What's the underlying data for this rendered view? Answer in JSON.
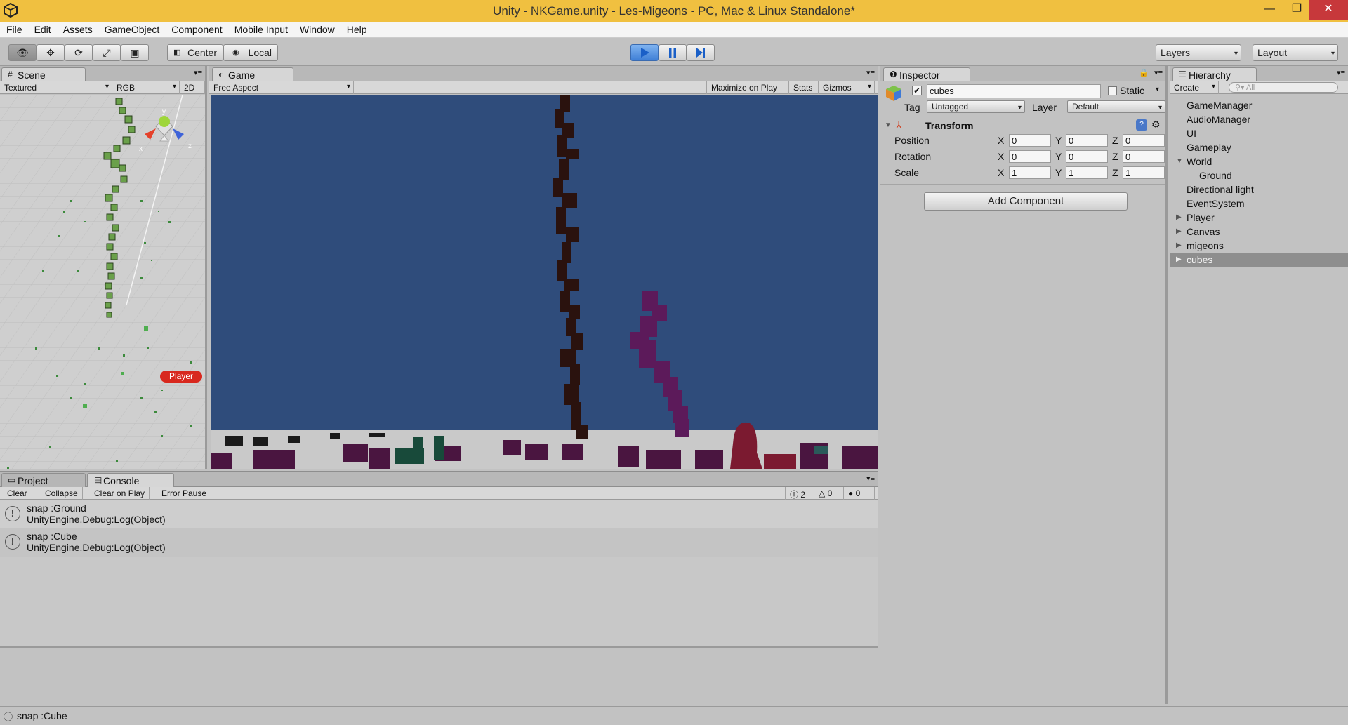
{
  "window": {
    "title": "Unity - NKGame.unity - Les-Migeons - PC, Mac & Linux Standalone*",
    "minimize": "—",
    "maximize": "❐",
    "close": "✕"
  },
  "menu": [
    "File",
    "Edit",
    "Assets",
    "GameObject",
    "Component",
    "Mobile Input",
    "Window",
    "Help"
  ],
  "toolbar": {
    "pivot": "Center",
    "space": "Local",
    "layers": "Layers",
    "layout": "Layout"
  },
  "scene": {
    "tab": "Scene",
    "render_mode": "Textured",
    "channel": "RGB",
    "mode2d": "2D",
    "player_label": "Player",
    "axis_y": "y",
    "axis_z": "z",
    "axis_x": "x"
  },
  "game": {
    "tab": "Game",
    "aspect": "Free Aspect",
    "maximize": "Maximize on Play",
    "stats": "Stats",
    "gizmos": "Gizmos"
  },
  "inspector": {
    "tab": "Inspector",
    "object_name": "cubes",
    "static_label": "Static",
    "tag_label": "Tag",
    "tag_value": "Untagged",
    "layer_label": "Layer",
    "layer_value": "Default",
    "component": "Transform",
    "rows": [
      {
        "label": "Position",
        "x": "0",
        "y": "0",
        "z": "0"
      },
      {
        "label": "Rotation",
        "x": "0",
        "y": "0",
        "z": "0"
      },
      {
        "label": "Scale",
        "x": "1",
        "y": "1",
        "z": "1"
      }
    ],
    "axis_x": "X",
    "axis_y": "Y",
    "axis_z": "Z",
    "add_component": "Add Component"
  },
  "hierarchy": {
    "tab": "Hierarchy",
    "create": "Create",
    "search_placeholder": "All",
    "items": [
      "GameManager",
      "AudioManager",
      "UI",
      "Gameplay",
      "World",
      "Ground",
      "Directional light",
      "EventSystem",
      "Player",
      "Canvas",
      "migeons",
      "cubes"
    ]
  },
  "bottom": {
    "project_tab": "Project",
    "console_tab": "Console"
  },
  "console": {
    "clear": "Clear",
    "collapse": "Collapse",
    "clear_on_play": "Clear on Play",
    "error_pause": "Error Pause",
    "log_count": "2",
    "warn_count": "0",
    "error_count": "0",
    "entries": [
      {
        "line1": "snap :Ground",
        "line2": "UnityEngine.Debug:Log(Object)"
      },
      {
        "line1": "snap :Cube",
        "line2": "UnityEngine.Debug:Log(Object)"
      }
    ]
  },
  "status": {
    "text": "snap :Cube"
  },
  "colors": {
    "title_bar": "#f0c040",
    "game_sky": "#2f4c7b",
    "selection": "#8e8e8e"
  }
}
